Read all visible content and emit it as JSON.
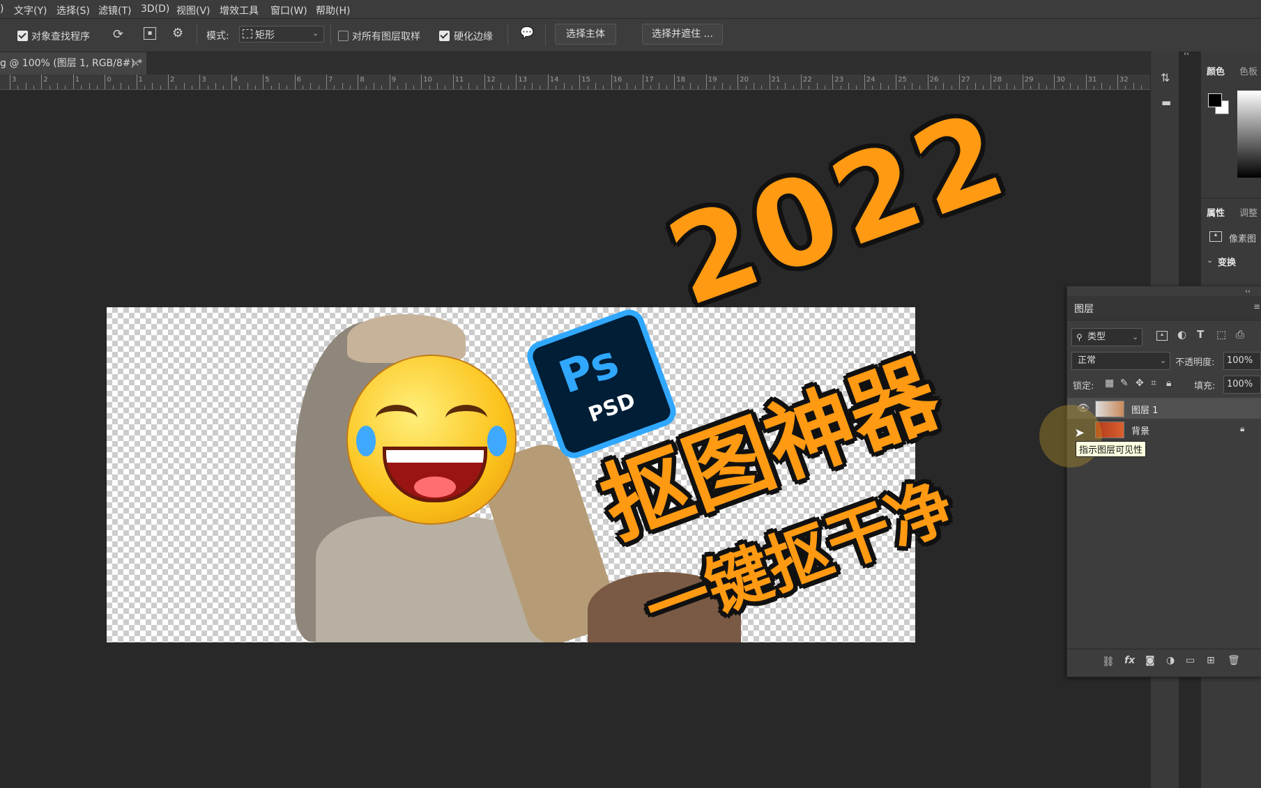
{
  "menubar": {
    "items": [
      ")",
      "文字(Y)",
      "选择(S)",
      "滤镜(T)",
      "3D(D)",
      "视图(V)",
      "增效工具",
      "窗口(W)",
      "帮助(H)"
    ]
  },
  "options": {
    "sample_all_label": "对象查找程序",
    "mode_label": "模式:",
    "mode_value": "矩形",
    "all_layers_label": "对所有图层取样",
    "hard_edge_label": "硬化边缘",
    "select_subject": "选择主体",
    "select_mask": "选择并遮住 ..."
  },
  "document": {
    "tab_title": "g @ 100% (图层 1, RGB/8#) *",
    "close": "×"
  },
  "ruler": {
    "labels": [
      "3",
      "2",
      "1",
      "0",
      "1",
      "2",
      "3",
      "4",
      "5",
      "6",
      "7",
      "8",
      "9",
      "10",
      "11",
      "12",
      "13",
      "14",
      "15",
      "16",
      "17",
      "18",
      "19",
      "20",
      "21",
      "22",
      "23",
      "24",
      "25",
      "26",
      "27",
      "28",
      "29",
      "30",
      "31",
      "32"
    ]
  },
  "right_panels": {
    "color_tab": "颜色",
    "swatch_tab": "色板",
    "properties_tab": "属性",
    "adjust_tab": "调整",
    "pixel_label": "像素图",
    "transform_label": "变换",
    "collapse": "‹‹"
  },
  "layers": {
    "title": "图层",
    "filter_kind": "类型",
    "blend_mode": "正常",
    "opacity_label": "不透明度:",
    "opacity_value": "100%",
    "lock_label": "锁定:",
    "fill_label": "填充:",
    "fill_value": "100%",
    "rows": [
      {
        "name": "图层 1",
        "visible": true
      },
      {
        "name": "背景",
        "visible": false,
        "locked": true
      }
    ],
    "tooltip": "指示图层可见性"
  },
  "overlay": {
    "year": "2022",
    "headline": "抠图神器",
    "subline": "一键抠干净",
    "ps": "Ps",
    "psd": "PSD"
  },
  "colors": {
    "accent_orange": "#ff9a12",
    "ps_blue": "#31a8ff",
    "ps_dark": "#001e36"
  }
}
